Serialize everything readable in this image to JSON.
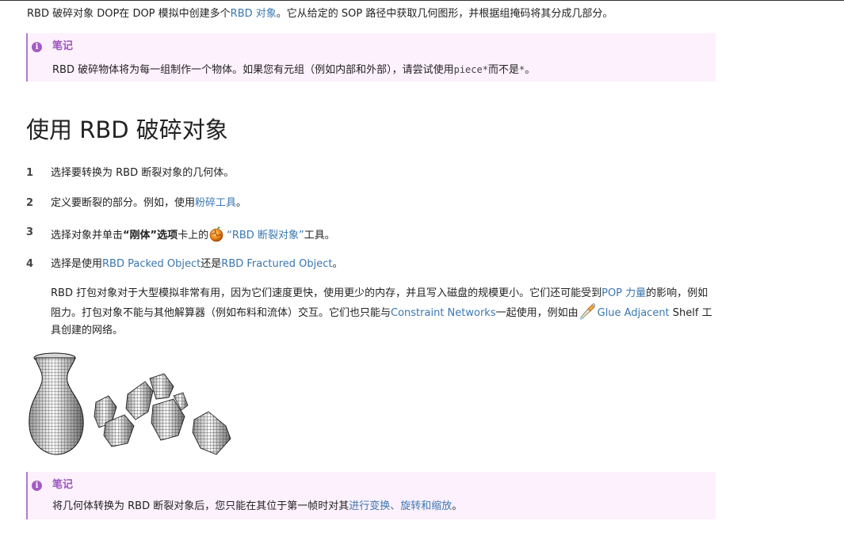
{
  "intro": {
    "before": "RBD 破碎对象 DOP在 DOP 模拟中创建多个",
    "link": "RBD 对象",
    "after": "。它从给定的 SOP 路径中获取几何图形，并根据组掩码将其分成几部分。"
  },
  "note1": {
    "title": "笔记",
    "body_before": "RBD 破碎物体将为每一组制作一个物体。如果您有元组（例如内部和外部），请尝试使用",
    "code1": "piece*",
    "mid": "而不是",
    "code2": "*",
    "end": "。"
  },
  "heading": "使用 RBD 破碎对象",
  "steps": [
    {
      "num": "1",
      "text": "选择要转换为 RBD 断裂对象的几何体。"
    },
    {
      "num": "2",
      "before": "定义要断裂的部分。例如，使用",
      "link": "粉碎工具",
      "after": "。"
    },
    {
      "num": "3",
      "before": "选择对象并单击",
      "bold1": "“刚体”选项",
      "mid": "卡上的",
      "link": "“RBD 断裂对象”",
      "after": "工具。"
    },
    {
      "num": "4",
      "before": "选择是使用",
      "link1": "RBD Packed Object",
      "mid": "还是",
      "link2": "RBD Fractured Object",
      "after": "。"
    }
  ],
  "para": {
    "t1": "RBD 打包对象对于大型模拟非常有用，因为它们速度更快，使用更少的内存，并且写入磁盘的规模更小。它们还可能受到",
    "link1": "POP 力量",
    "t2": "的影响，例如阻力。打包对象不能与其他解算器（例如布料和流体）交互。它们也只能与",
    "link2": "Constraint Networks",
    "t3": "一起使用，例如由",
    "link3": "Glue Adjacent",
    "t4": " Shelf 工具创建的网络。"
  },
  "note2": {
    "title": "笔记",
    "before": "将几何体转换为 RBD 断裂对象后，您只能在其位于第一帧时对其",
    "link": "进行变换、旋转和缩放",
    "after": "。"
  },
  "colors": {
    "link": "#3a77b0",
    "note_bg": "#fdf1fd",
    "note_accent": "#9b55bf"
  },
  "icons": [
    "info-icon",
    "rbd-fracture-tool-icon",
    "glue-adjacent-tool-icon"
  ]
}
